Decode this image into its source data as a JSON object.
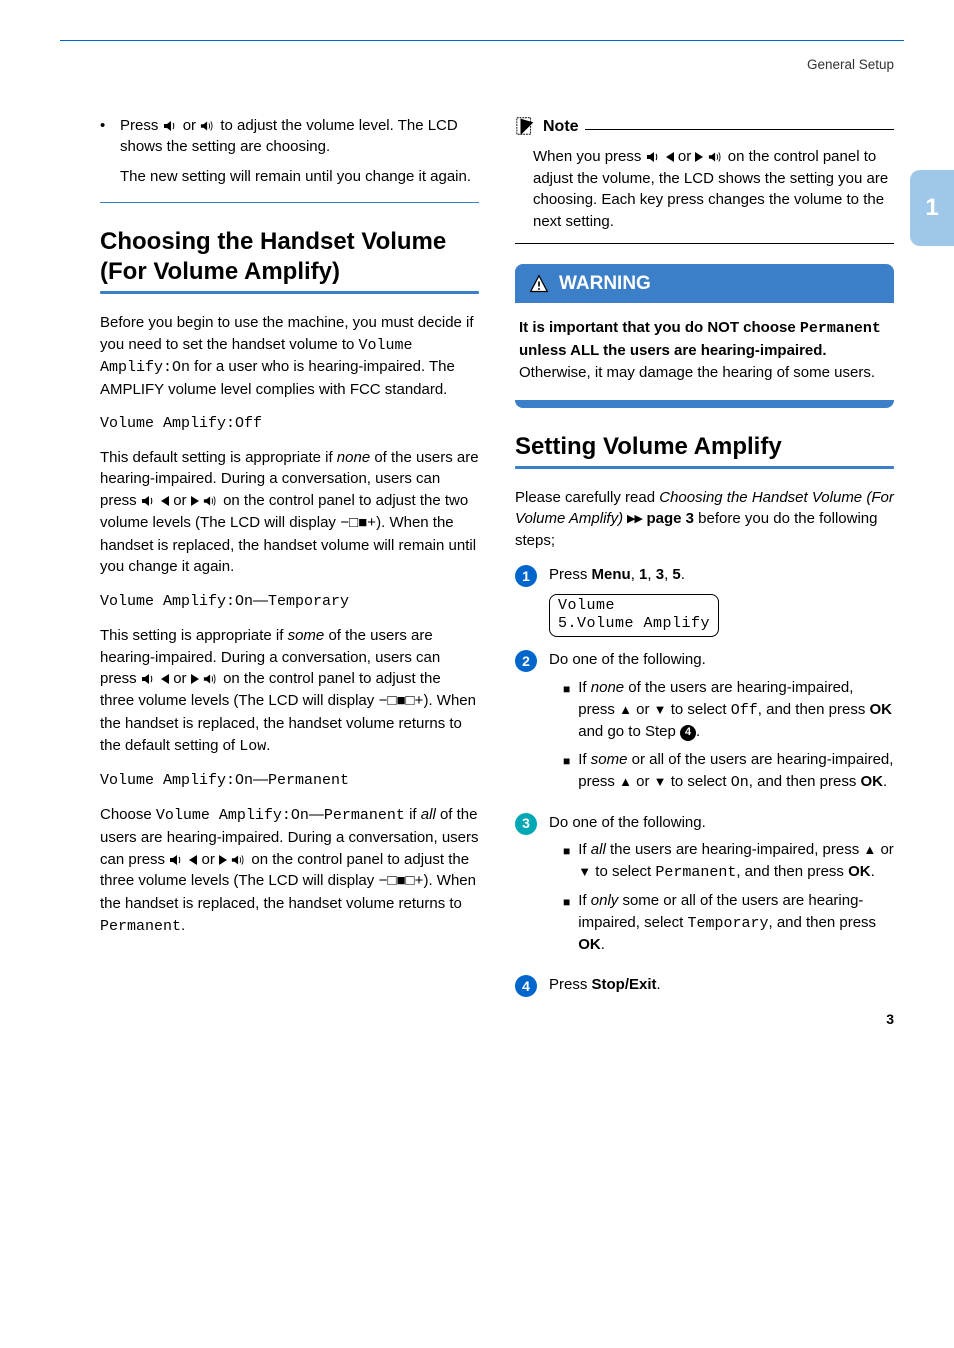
{
  "header": {
    "section": "General Setup"
  },
  "sideTab": "1",
  "left": {
    "bullet1_a": "Press ",
    "bullet1_b": " or ",
    "bullet1_c": " to adjust the volume level. The LCD shows the setting are choosing.",
    "bullet1_follow": "The new setting will remain until you change it again.",
    "h2": "Choosing the Handset Volume (For Volume Amplify)",
    "p1_a": "Before you begin to use the machine, you must decide if you need to set the handset volume to ",
    "p1_code": "Volume Amplify:On",
    "p1_b": " for a user who is hearing-impaired. The AMPLIFY volume level complies with FCC standard.",
    "code_off": "Volume Amplify:Off",
    "p2_a": "This default setting is appropriate if ",
    "p2_em": "none",
    "p2_b": " of the users are hearing-impaired. During a conversation, users can press ",
    "p2_c": " or ",
    "p2_d": " on the control panel to adjust the two volume levels (The LCD will display ",
    "p2_lcd": "−□■+",
    "p2_e": "). When the handset is replaced, the handset volume will remain until you change it again.",
    "code_on_temp_a": "Volume Amplify:On",
    "code_on_temp_dash": "—",
    "code_on_temp_b": "Temporary",
    "p3_a": "This setting is appropriate if ",
    "p3_em": "some",
    "p3_b": " of the users are hearing-impaired. During a conversation, users can press ",
    "p3_c": " or ",
    "p3_d": " on the control panel to adjust the three volume levels (The LCD will display ",
    "p3_lcd": "−□■□+",
    "p3_e": "). When the handset is replaced, the handset volume returns to the default setting of ",
    "p3_low": "Low",
    "p3_f": ".",
    "code_on_perm_a": "Volume Amplify:On",
    "code_on_perm_dash": "—",
    "code_on_perm_b": "Permanent",
    "p4_a": "Choose ",
    "p4_code": "Volume Amplify:On",
    "p4_dash": "—",
    "p4_code2": "Permanent",
    "p4_b": " if ",
    "p4_em": "all",
    "p4_c": " of the users are hearing-impaired. During a conversation, users can press ",
    "p4_d": " or ",
    "p4_e": " on the control panel to adjust the three volume levels (The LCD will display ",
    "p4_lcd": "−□■□+",
    "p4_f": "). When the handset is replaced, the handset volume returns to ",
    "p4_code3": "Permanent",
    "p4_g": "."
  },
  "right": {
    "note_label": "Note",
    "note_a": "When you press ",
    "note_b": " or ",
    "note_c": " on the control panel to adjust the volume, the LCD shows the setting you are choosing. Each key press changes the volume to the next setting.",
    "warn_label": "WARNING",
    "warn_a": "It is important that you do NOT choose ",
    "warn_code": "Permanent",
    "warn_b": " unless ALL the users are hearing-impaired.",
    "warn_c": " Otherwise, it may damage the hearing of some users.",
    "h2": "Setting Volume Amplify",
    "intro_a": "Please carefully read ",
    "intro_em": "Choosing the Handset Volume (For Volume Amplify)",
    "intro_b": " ",
    "intro_xref": "▸▸ page 3",
    "intro_c": " before you do the following steps;",
    "s1_a": "Press ",
    "s1_menu": "Menu",
    "s1_b": ", ",
    "s1_k1": "1",
    "s1_c": ", ",
    "s1_k2": "3",
    "s1_d": ", ",
    "s1_k3": "5",
    "s1_e": ".",
    "lcd_line1": "Volume",
    "lcd_line2": "5.Volume Amplify",
    "s2": "Do one of the following.",
    "s2a_a": "If ",
    "s2a_em": "none",
    "s2a_b": " of the users are hearing-impaired, press ",
    "s2a_c": " or ",
    "s2a_d": " to select ",
    "s2a_code": "Off",
    "s2a_e": ", and then press ",
    "s2a_ok": "OK",
    "s2a_f": " and go to Step ",
    "s2a_ref": "④",
    "s2a_g": ".",
    "s2b_a": "If ",
    "s2b_em": "some",
    "s2b_b": " or all of the users are hearing-impaired, press ",
    "s2b_c": " or ",
    "s2b_d": " to select ",
    "s2b_code": "On",
    "s2b_e": ", and then press ",
    "s2b_ok": "OK",
    "s2b_f": ".",
    "s3": "Do one of the following.",
    "s3a_a": "If ",
    "s3a_em": "all",
    "s3a_b": " the users are hearing-impaired, press ",
    "s3a_c": " or ",
    "s3a_d": " to select ",
    "s3a_code": "Permanent",
    "s3a_e": ", and then press ",
    "s3a_ok": "OK",
    "s3a_f": ".",
    "s3b_a": "If ",
    "s3b_em": "only",
    "s3b_b": " some or all of the users are hearing-impaired, select ",
    "s3b_code": "Temporary",
    "s3b_c": ", and then press ",
    "s3b_ok": "OK",
    "s3b_d": ".",
    "s4_a": "Press ",
    "s4_b": "Stop/Exit",
    "s4_c": "."
  },
  "pagenum": "3"
}
